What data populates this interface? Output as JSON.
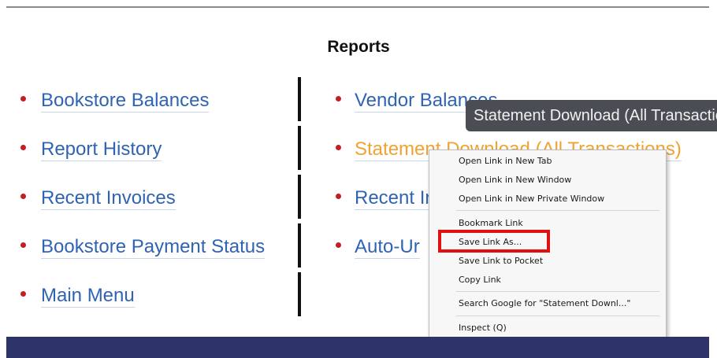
{
  "reports": {
    "title": "Reports",
    "left_links": [
      "Bookstore Balances",
      "Report History",
      "Recent Invoices",
      "Bookstore Payment Status",
      "Main Menu"
    ],
    "right_links": [
      "Vendor Balances",
      "Statement Download (All Transactions)",
      "Recent Invoices",
      "Auto-Ur"
    ]
  },
  "tooltip": "Statement Download (All Transactions)",
  "context_menu": {
    "items": [
      "Open Link in New Tab",
      "Open Link in New Window",
      "Open Link in New Private Window",
      "Bookmark Link",
      "Save Link As...",
      "Save Link to Pocket",
      "Copy Link",
      "Search Google for \"Statement Downl...\"",
      "Inspect (Q)"
    ]
  },
  "colors": {
    "link": "#2f63b3",
    "link_hover": "#f2a233",
    "bullet": "#c41e24",
    "footer": "#2e3468",
    "highlight": "#e01010"
  }
}
